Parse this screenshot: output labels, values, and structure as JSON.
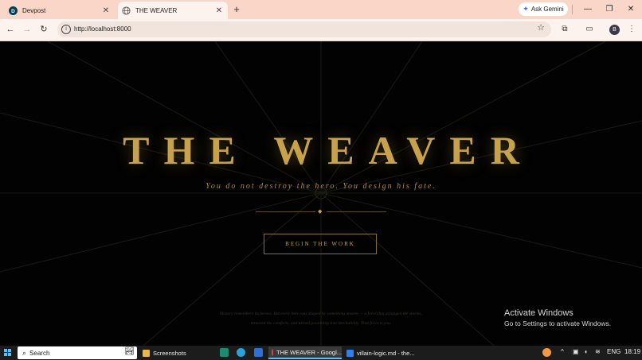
{
  "browser": {
    "tabs": [
      {
        "title": "Devpost",
        "active": false,
        "icon": "devpost-icon"
      },
      {
        "title": "THE WEAVER",
        "active": true,
        "icon": "globe-icon"
      }
    ],
    "new_tab_glyph": "+",
    "ask_gemini_label": "Ask Gemini",
    "url": "http://localhost:8000",
    "profile_initial": "B"
  },
  "page": {
    "title": "THE WEAVER",
    "tagline": "You do not destroy the hero. You design his fate.",
    "cta_label": "BEGIN THE WORK",
    "footer_line1": "History remembers its heroes. But every hero was shaped by something unseen — a force that arranged the storms,",
    "footer_line2": "removed the comforts, and turned possibility into inevitability. That force is you.",
    "accent_color": "#c7a24b"
  },
  "watermark": {
    "title": "Activate Windows",
    "subtitle": "Go to Settings to activate Windows."
  },
  "taskbar": {
    "search_placeholder": "Search",
    "apps": [
      {
        "label": "Screenshots",
        "icon": "folder-icon"
      },
      {
        "label": "THE WEAVER - Googl...",
        "icon": "chrome-icon"
      },
      {
        "label": "villain-logic.md - the...",
        "icon": "vscode-icon"
      }
    ],
    "language": "ENG",
    "time": "18:19"
  }
}
